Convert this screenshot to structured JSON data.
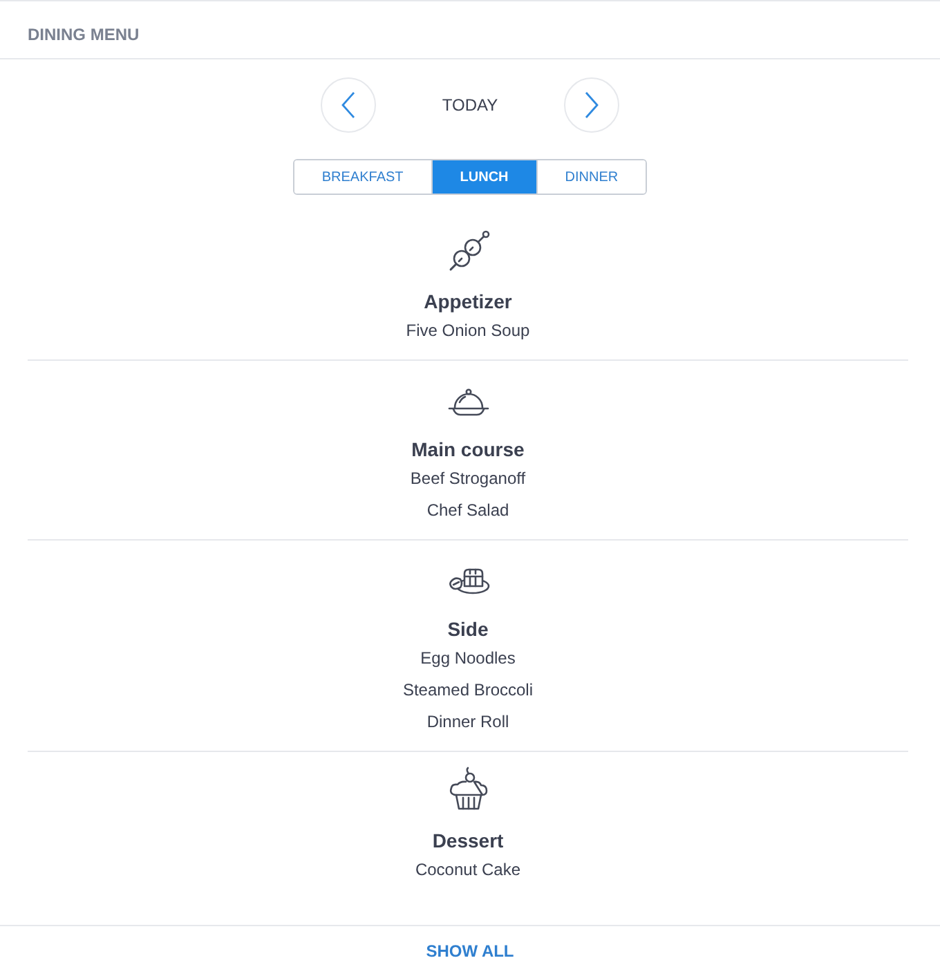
{
  "header": {
    "title": "DINING MENU"
  },
  "date_nav": {
    "label": "TODAY"
  },
  "tabs": [
    {
      "label": "BREAKFAST",
      "selected": false
    },
    {
      "label": "LUNCH",
      "selected": true
    },
    {
      "label": "DINNER",
      "selected": false
    }
  ],
  "courses": [
    {
      "kind": "skewer",
      "title": "Appetizer",
      "items": [
        "Five Onion Soup"
      ]
    },
    {
      "kind": "cloche",
      "title": "Main course",
      "items": [
        "Beef Stroganoff",
        "Chef Salad"
      ]
    },
    {
      "kind": "toast",
      "title": "Side",
      "items": [
        "Egg Noodles",
        "Steamed Broccoli",
        "Dinner Roll"
      ]
    },
    {
      "kind": "cupcake",
      "title": "Dessert",
      "items": [
        "Coconut Cake"
      ]
    }
  ],
  "footer": {
    "link": "SHOW ALL"
  }
}
